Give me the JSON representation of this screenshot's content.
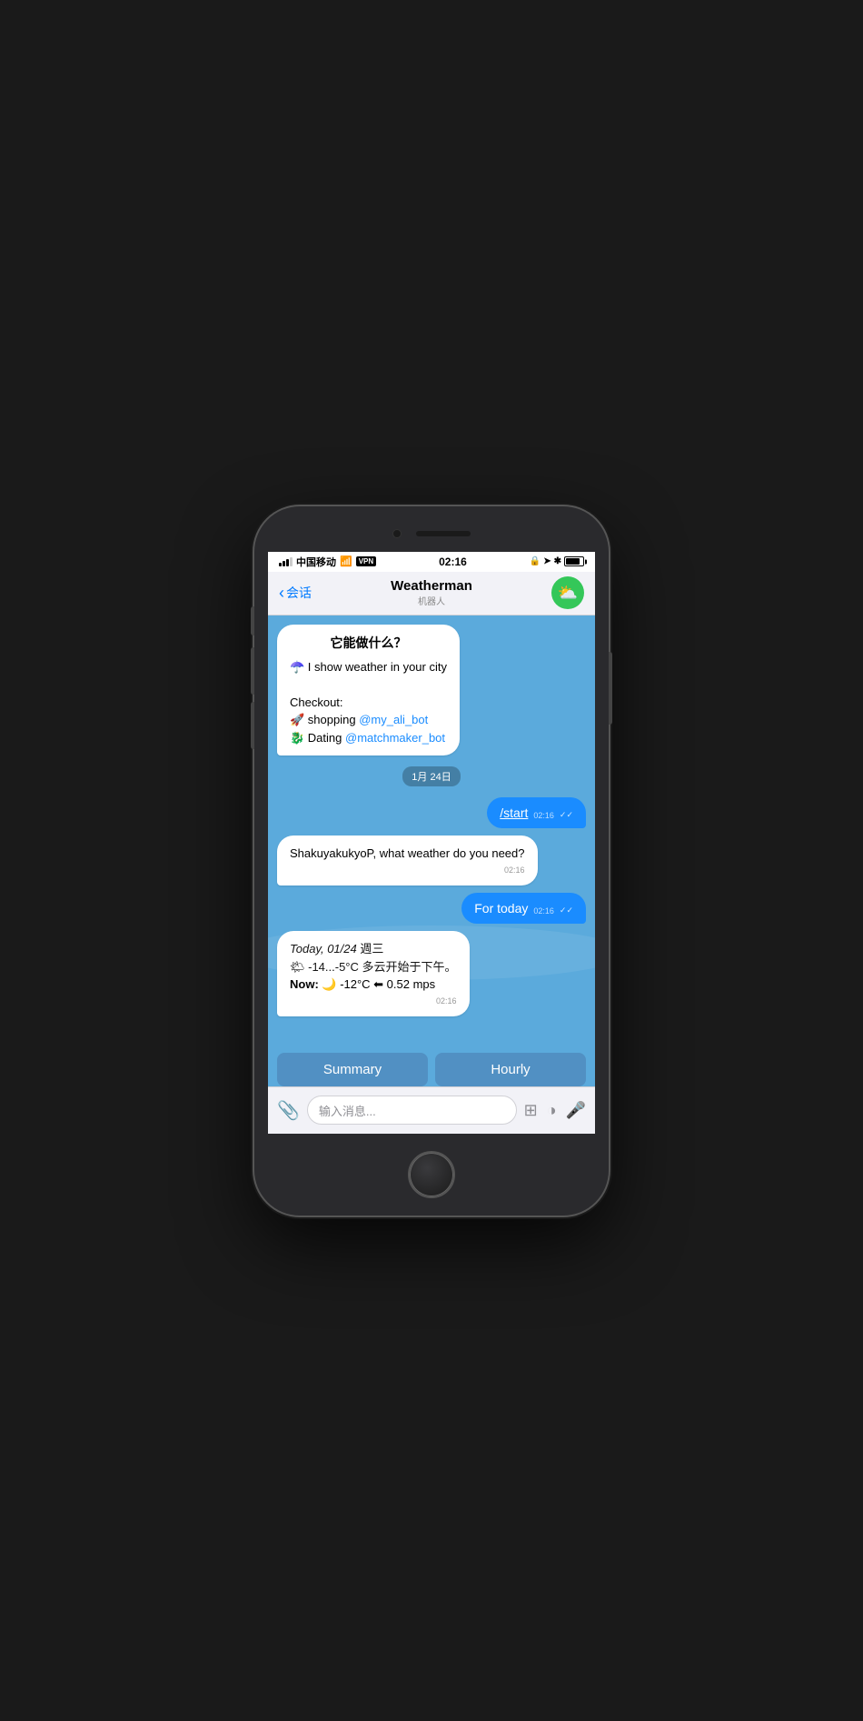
{
  "status_bar": {
    "carrier": "中国移动",
    "wifi": "WiFi",
    "vpn": "VPN",
    "time": "02:16",
    "battery": "85%"
  },
  "nav": {
    "back_label": "会话",
    "title": "Weatherman",
    "subtitle": "机器人",
    "avatar_emoji": "⛅"
  },
  "messages": [
    {
      "type": "bot",
      "id": "intro",
      "title": "它能做什么？",
      "lines": [
        "☂️ I show weather in your city",
        "",
        "Checkout:",
        "🚀 shopping @my_ali_bot",
        "🐉 Dating @matchmaker_bot"
      ]
    },
    {
      "type": "date",
      "text": "1月 24日"
    },
    {
      "type": "user",
      "text": "/start",
      "time": "02:16",
      "checks": "✓✓"
    },
    {
      "type": "bot",
      "id": "question",
      "text": "ShakuyakukyoP, what weather do you need?",
      "time": "02:16"
    },
    {
      "type": "user",
      "text": "For today",
      "time": "02:16",
      "checks": "✓✓"
    },
    {
      "type": "bot",
      "id": "weather",
      "line1": "Today, 01/24 週三",
      "line2": "🌤 -14...-5°C 多云开始于下午。",
      "line3": "Now: 🌙 -12°C ⬅ 0.52 mps",
      "time": "02:16"
    }
  ],
  "quick_replies": {
    "summary": "Summary",
    "hourly": "Hourly"
  },
  "input": {
    "placeholder": "输入消息..."
  }
}
